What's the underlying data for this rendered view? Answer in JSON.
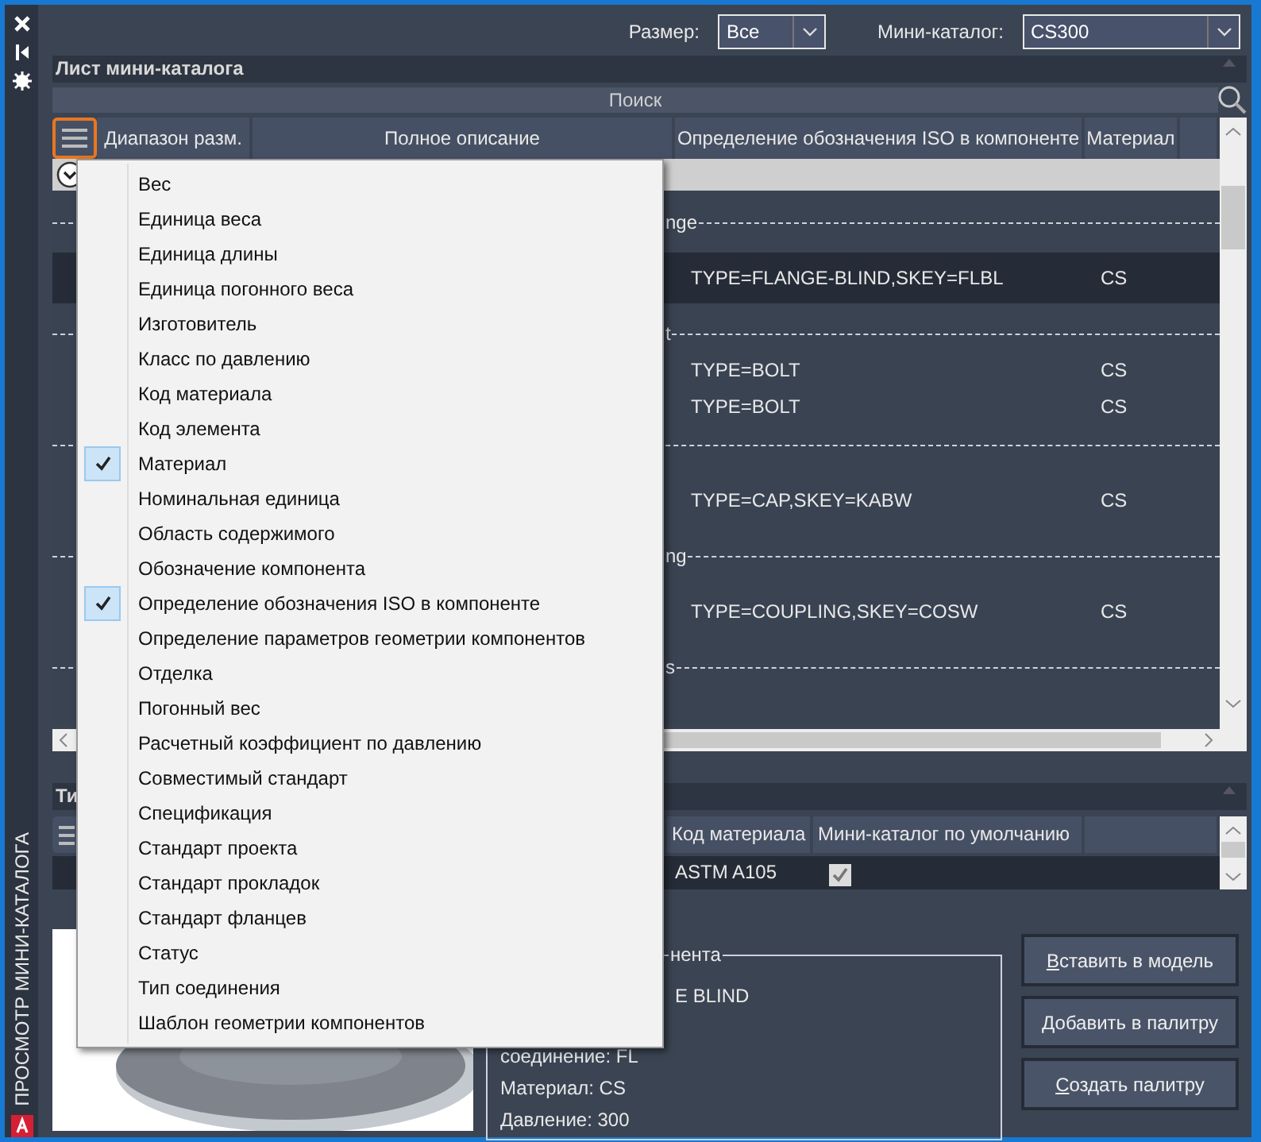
{
  "window": {
    "side_title": "ПРОСМОТР МИНИ-КАТАЛОГА"
  },
  "filters": [
    {
      "label": "Размер:",
      "value": "Все"
    },
    {
      "label": "Мини-каталог:",
      "value": "CS300"
    }
  ],
  "catalog_sheet": {
    "title": "Лист мини-каталога",
    "search": {
      "placeholder": "Поиск"
    },
    "columns": [
      "Диапазон разм.",
      "Полное описание",
      "Определение обозначения ISO в компоненте",
      "Материал"
    ],
    "groups": [
      {
        "label": "nge",
        "rows": [
          {
            "iso": "TYPE=FLANGE-BLIND,SKEY=FLBL",
            "material": "CS",
            "selected": true
          }
        ]
      },
      {
        "label": "t",
        "rows": [
          {
            "iso": "TYPE=BOLT",
            "material": "CS",
            "selected": false
          },
          {
            "iso": "TYPE=BOLT",
            "material": "CS",
            "selected": false
          }
        ]
      },
      {
        "rows": [
          {
            "iso": "TYPE=CAP,SKEY=KABW",
            "material": "CS",
            "selected": false
          }
        ]
      },
      {
        "label": "ng",
        "rows": [
          {
            "iso": "TYPE=COUPLING,SKEY=COSW",
            "material": "CS",
            "selected": false
          }
        ]
      },
      {
        "label": "s"
      }
    ]
  },
  "column_menu": {
    "items": [
      {
        "label": "Вес",
        "checked": false
      },
      {
        "label": "Единица веса",
        "checked": false
      },
      {
        "label": "Единица длины",
        "checked": false
      },
      {
        "label": "Единица погонного веса",
        "checked": false
      },
      {
        "label": "Изготовитель",
        "checked": false
      },
      {
        "label": "Класс по давлению",
        "checked": false
      },
      {
        "label": "Код материала",
        "checked": false
      },
      {
        "label": "Код элемента",
        "checked": false
      },
      {
        "label": "Материал",
        "checked": true
      },
      {
        "label": "Номинальная единица",
        "checked": false
      },
      {
        "label": "Область содержимого",
        "checked": false
      },
      {
        "label": "Обозначение компонента",
        "checked": false
      },
      {
        "label": "Определение обозначения ISO в компоненте",
        "checked": true
      },
      {
        "label": "Определение параметров геометрии компонентов",
        "checked": false
      },
      {
        "label": "Отделка",
        "checked": false
      },
      {
        "label": "Погонный вес",
        "checked": false
      },
      {
        "label": "Расчетный коэффициент по давлению",
        "checked": false
      },
      {
        "label": "Совместимый стандарт",
        "checked": false
      },
      {
        "label": "Спецификация",
        "checked": false
      },
      {
        "label": "Стандарт проекта",
        "checked": false
      },
      {
        "label": "Стандарт прокладок",
        "checked": false
      },
      {
        "label": "Стандарт фланцев",
        "checked": false
      },
      {
        "label": "Статус",
        "checked": false
      },
      {
        "label": "Тип соединения",
        "checked": false
      },
      {
        "label": "Шаблон геометрии компонентов",
        "checked": false
      }
    ]
  },
  "types": {
    "title": "Ти",
    "columns": [
      "Код материала",
      "Мини-каталог по умолчанию"
    ],
    "rows": [
      {
        "material_code": "ASTM A105",
        "default": true
      }
    ]
  },
  "component_info": {
    "legend": "нента",
    "lines": [
      "E BLIND",
      "соединение: FL",
      "Материал: CS",
      "Давление: 300"
    ]
  },
  "buttons": [
    "Вставить в модель",
    "Добавить в палитру",
    "Создать палитру"
  ]
}
